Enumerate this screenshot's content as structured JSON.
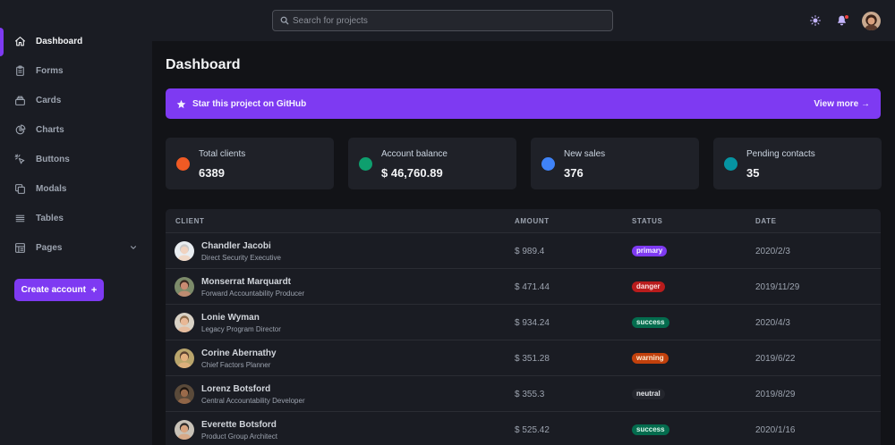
{
  "sidebar": {
    "items": [
      {
        "label": "Dashboard",
        "icon": "home-icon",
        "active": true
      },
      {
        "label": "Forms",
        "icon": "clipboard-icon"
      },
      {
        "label": "Cards",
        "icon": "cards-icon"
      },
      {
        "label": "Charts",
        "icon": "pie-chart-icon"
      },
      {
        "label": "Buttons",
        "icon": "cursor-click-icon"
      },
      {
        "label": "Modals",
        "icon": "modals-icon"
      },
      {
        "label": "Tables",
        "icon": "table-icon"
      },
      {
        "label": "Pages",
        "icon": "pages-icon",
        "has_submenu": true
      }
    ],
    "create_button": {
      "label": "Create account",
      "icon": "+"
    }
  },
  "header": {
    "search_placeholder": "Search for projects",
    "notification_dot_color": "#ef4444"
  },
  "main": {
    "title": "Dashboard",
    "banner": {
      "text": "Star this project on GitHub",
      "link": "View more →",
      "color": "#7e3af2"
    },
    "cards": [
      {
        "label": "Total clients",
        "value": "6389",
        "color": "#f05a24"
      },
      {
        "label": "Account balance",
        "value": "$ 46,760.89",
        "color": "#0e9f6e"
      },
      {
        "label": "New sales",
        "value": "376",
        "color": "#3f83f8"
      },
      {
        "label": "Pending contacts",
        "value": "35",
        "color": "#0694a2"
      }
    ],
    "table": {
      "headers": [
        "CLIENT",
        "AMOUNT",
        "STATUS",
        "DATE"
      ],
      "rows": [
        {
          "name": "Chandler Jacobi",
          "role": "Direct Security Executive",
          "amount": "$ 989.4",
          "status": "primary",
          "date": "2020/2/3",
          "skin": "#f1d3c0",
          "hair": "#c9c9c9",
          "bg": "#e9edf1"
        },
        {
          "name": "Monserrat Marquardt",
          "role": "Forward Accountability Producer",
          "amount": "$ 471.44",
          "status": "danger",
          "date": "2019/11/29",
          "skin": "#c98b72",
          "hair": "#3a2a22",
          "bg": "#7c8b6a"
        },
        {
          "name": "Lonie Wyman",
          "role": "Legacy Program Director",
          "amount": "$ 934.24",
          "status": "success",
          "date": "2020/4/3",
          "skin": "#e8b896",
          "hair": "#8a6a4a",
          "bg": "#d9d2c6"
        },
        {
          "name": "Corine Abernathy",
          "role": "Chief Factors Planner",
          "amount": "$ 351.28",
          "status": "warning",
          "date": "2019/6/22",
          "skin": "#e2b07f",
          "hair": "#5a4030",
          "bg": "#b9a56c"
        },
        {
          "name": "Lorenz Botsford",
          "role": "Central Accountability Developer",
          "amount": "$ 355.3",
          "status": "neutral",
          "date": "2019/8/29",
          "skin": "#9a6a4a",
          "hair": "#1e1610",
          "bg": "#5a4a3a"
        },
        {
          "name": "Everette Botsford",
          "role": "Product Group Architect",
          "amount": "$ 525.42",
          "status": "success",
          "date": "2020/1/16",
          "skin": "#d9a47f",
          "hair": "#2e2a28",
          "bg": "#c8c2b8"
        }
      ]
    }
  }
}
